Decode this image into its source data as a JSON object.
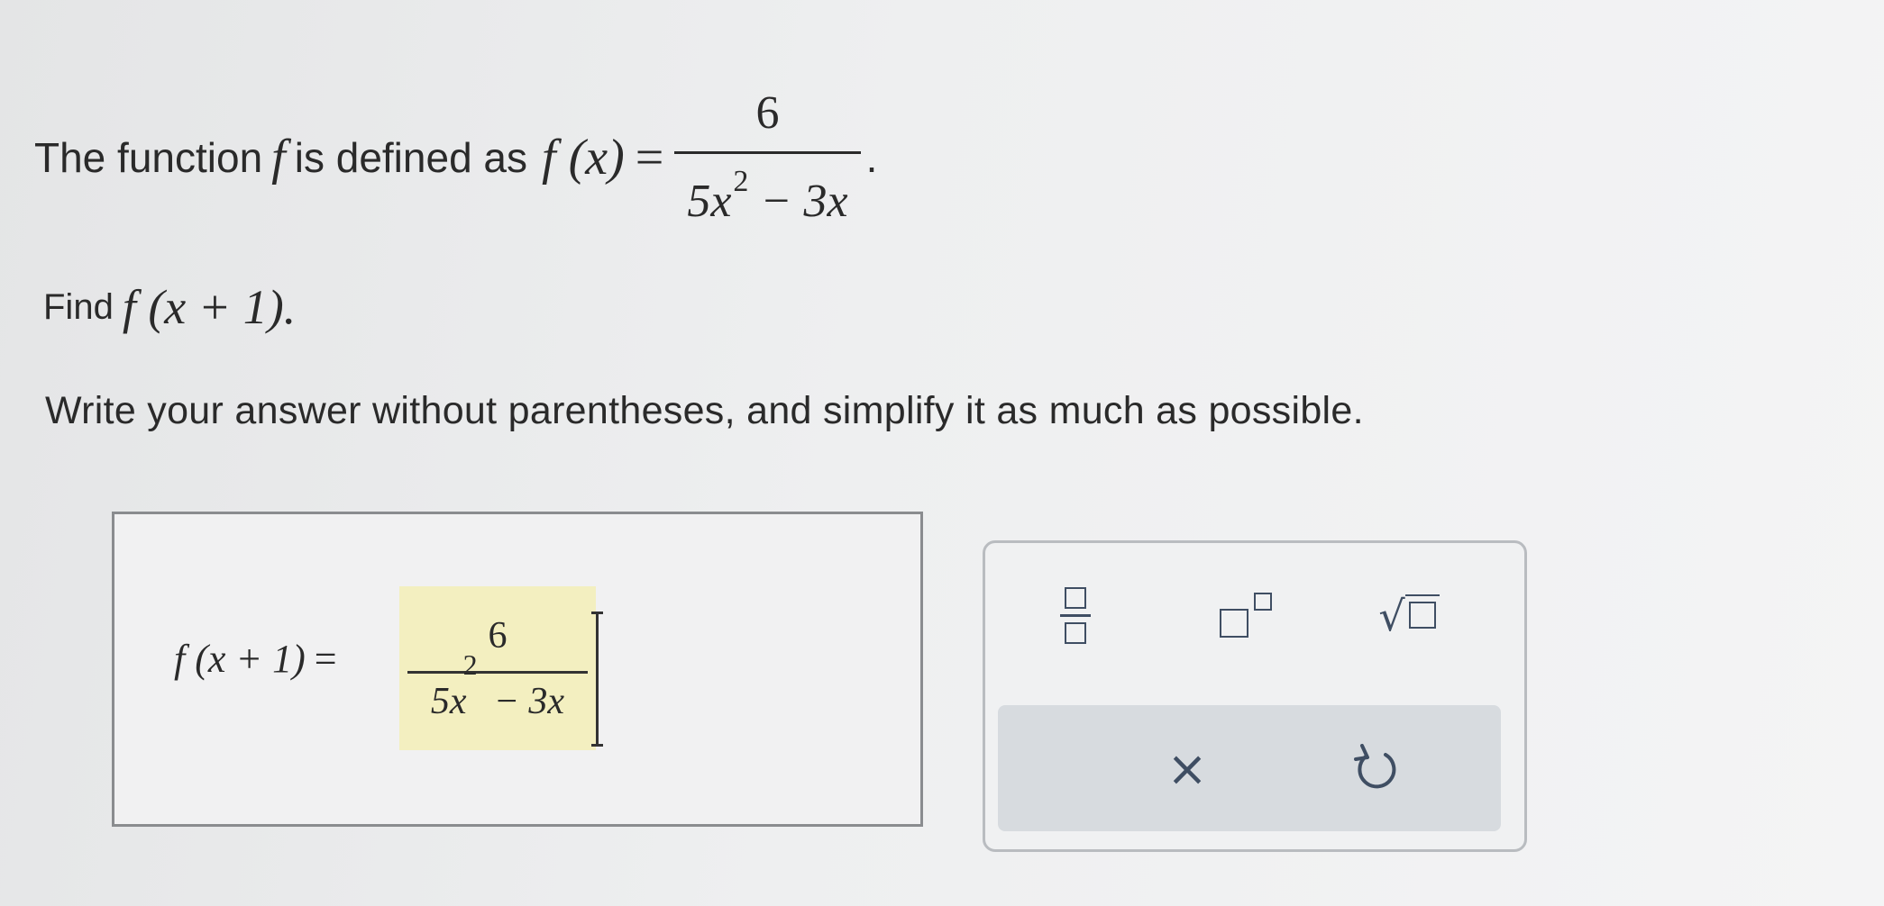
{
  "problem": {
    "intro_text": "The function",
    "func_name": "f",
    "defined_text": "is defined as",
    "fx_text": "f (x)",
    "equals": "=",
    "numerator": "6",
    "denominator_prefix": "5x",
    "denominator_exp": "2",
    "denominator_suffix": "− 3x",
    "period": ".",
    "find_text": "Find",
    "find_expr": "f (x + 1).",
    "instruction": "Write your answer without parentheses, and simplify it as much as possible."
  },
  "answer": {
    "label": "f (x + 1)",
    "equals": "=",
    "numerator": "6",
    "denominator_prefix": "5x",
    "denominator_exp": "2",
    "denominator_suffix": "− 3x"
  },
  "toolbar": {
    "clear_label": "×",
    "icons": [
      "fraction-icon",
      "exponent-icon",
      "square-root-icon",
      "clear-icon",
      "undo-icon"
    ]
  },
  "colors": {
    "answer_highlight": "#f3efc0",
    "icon": "#3f4e63",
    "action_bar": "#d7dbdf"
  }
}
